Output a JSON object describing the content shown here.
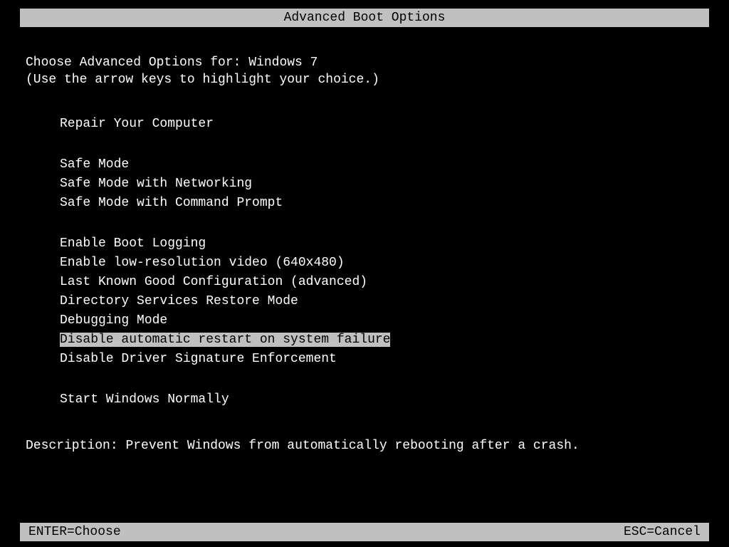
{
  "title": "Advanced Boot Options",
  "header": {
    "line1": "Choose Advanced Options for: Windows 7",
    "line2": "(Use the arrow keys to highlight your choice.)"
  },
  "menu": {
    "group1": [
      "Repair Your Computer"
    ],
    "group2": [
      "Safe Mode",
      "Safe Mode with Networking",
      "Safe Mode with Command Prompt"
    ],
    "group3": [
      "Enable Boot Logging",
      "Enable low-resolution video (640x480)",
      "Last Known Good Configuration (advanced)",
      "Directory Services Restore Mode",
      "Debugging Mode",
      "Disable automatic restart on system failure",
      "Disable Driver Signature Enforcement"
    ],
    "group4": [
      "Start Windows Normally"
    ],
    "selected_index": 9
  },
  "description": {
    "label": "Description:",
    "text": "Prevent Windows from automatically rebooting after a crash."
  },
  "footer": {
    "left": "ENTER=Choose",
    "right": "ESC=Cancel"
  }
}
